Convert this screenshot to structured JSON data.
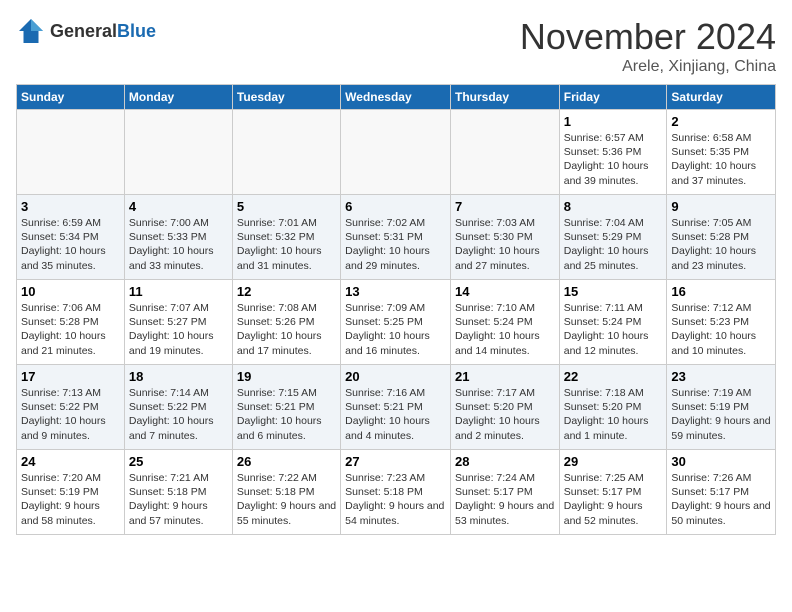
{
  "header": {
    "logo_line1": "General",
    "logo_line2": "Blue",
    "month": "November 2024",
    "location": "Arele, Xinjiang, China"
  },
  "weekdays": [
    "Sunday",
    "Monday",
    "Tuesday",
    "Wednesday",
    "Thursday",
    "Friday",
    "Saturday"
  ],
  "weeks": [
    [
      {
        "day": "",
        "info": ""
      },
      {
        "day": "",
        "info": ""
      },
      {
        "day": "",
        "info": ""
      },
      {
        "day": "",
        "info": ""
      },
      {
        "day": "",
        "info": ""
      },
      {
        "day": "1",
        "info": "Sunrise: 6:57 AM\nSunset: 5:36 PM\nDaylight: 10 hours and 39 minutes."
      },
      {
        "day": "2",
        "info": "Sunrise: 6:58 AM\nSunset: 5:35 PM\nDaylight: 10 hours and 37 minutes."
      }
    ],
    [
      {
        "day": "3",
        "info": "Sunrise: 6:59 AM\nSunset: 5:34 PM\nDaylight: 10 hours and 35 minutes."
      },
      {
        "day": "4",
        "info": "Sunrise: 7:00 AM\nSunset: 5:33 PM\nDaylight: 10 hours and 33 minutes."
      },
      {
        "day": "5",
        "info": "Sunrise: 7:01 AM\nSunset: 5:32 PM\nDaylight: 10 hours and 31 minutes."
      },
      {
        "day": "6",
        "info": "Sunrise: 7:02 AM\nSunset: 5:31 PM\nDaylight: 10 hours and 29 minutes."
      },
      {
        "day": "7",
        "info": "Sunrise: 7:03 AM\nSunset: 5:30 PM\nDaylight: 10 hours and 27 minutes."
      },
      {
        "day": "8",
        "info": "Sunrise: 7:04 AM\nSunset: 5:29 PM\nDaylight: 10 hours and 25 minutes."
      },
      {
        "day": "9",
        "info": "Sunrise: 7:05 AM\nSunset: 5:28 PM\nDaylight: 10 hours and 23 minutes."
      }
    ],
    [
      {
        "day": "10",
        "info": "Sunrise: 7:06 AM\nSunset: 5:28 PM\nDaylight: 10 hours and 21 minutes."
      },
      {
        "day": "11",
        "info": "Sunrise: 7:07 AM\nSunset: 5:27 PM\nDaylight: 10 hours and 19 minutes."
      },
      {
        "day": "12",
        "info": "Sunrise: 7:08 AM\nSunset: 5:26 PM\nDaylight: 10 hours and 17 minutes."
      },
      {
        "day": "13",
        "info": "Sunrise: 7:09 AM\nSunset: 5:25 PM\nDaylight: 10 hours and 16 minutes."
      },
      {
        "day": "14",
        "info": "Sunrise: 7:10 AM\nSunset: 5:24 PM\nDaylight: 10 hours and 14 minutes."
      },
      {
        "day": "15",
        "info": "Sunrise: 7:11 AM\nSunset: 5:24 PM\nDaylight: 10 hours and 12 minutes."
      },
      {
        "day": "16",
        "info": "Sunrise: 7:12 AM\nSunset: 5:23 PM\nDaylight: 10 hours and 10 minutes."
      }
    ],
    [
      {
        "day": "17",
        "info": "Sunrise: 7:13 AM\nSunset: 5:22 PM\nDaylight: 10 hours and 9 minutes."
      },
      {
        "day": "18",
        "info": "Sunrise: 7:14 AM\nSunset: 5:22 PM\nDaylight: 10 hours and 7 minutes."
      },
      {
        "day": "19",
        "info": "Sunrise: 7:15 AM\nSunset: 5:21 PM\nDaylight: 10 hours and 6 minutes."
      },
      {
        "day": "20",
        "info": "Sunrise: 7:16 AM\nSunset: 5:21 PM\nDaylight: 10 hours and 4 minutes."
      },
      {
        "day": "21",
        "info": "Sunrise: 7:17 AM\nSunset: 5:20 PM\nDaylight: 10 hours and 2 minutes."
      },
      {
        "day": "22",
        "info": "Sunrise: 7:18 AM\nSunset: 5:20 PM\nDaylight: 10 hours and 1 minute."
      },
      {
        "day": "23",
        "info": "Sunrise: 7:19 AM\nSunset: 5:19 PM\nDaylight: 9 hours and 59 minutes."
      }
    ],
    [
      {
        "day": "24",
        "info": "Sunrise: 7:20 AM\nSunset: 5:19 PM\nDaylight: 9 hours and 58 minutes."
      },
      {
        "day": "25",
        "info": "Sunrise: 7:21 AM\nSunset: 5:18 PM\nDaylight: 9 hours and 57 minutes."
      },
      {
        "day": "26",
        "info": "Sunrise: 7:22 AM\nSunset: 5:18 PM\nDaylight: 9 hours and 55 minutes."
      },
      {
        "day": "27",
        "info": "Sunrise: 7:23 AM\nSunset: 5:18 PM\nDaylight: 9 hours and 54 minutes."
      },
      {
        "day": "28",
        "info": "Sunrise: 7:24 AM\nSunset: 5:17 PM\nDaylight: 9 hours and 53 minutes."
      },
      {
        "day": "29",
        "info": "Sunrise: 7:25 AM\nSunset: 5:17 PM\nDaylight: 9 hours and 52 minutes."
      },
      {
        "day": "30",
        "info": "Sunrise: 7:26 AM\nSunset: 5:17 PM\nDaylight: 9 hours and 50 minutes."
      }
    ]
  ]
}
